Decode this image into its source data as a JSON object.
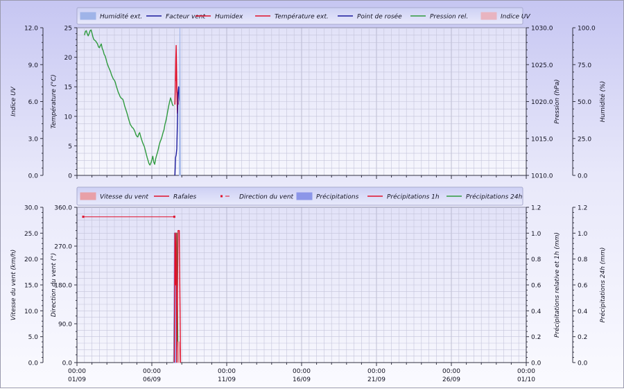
{
  "chart_data": [
    {
      "type": "line",
      "x_axis": {
        "min": "2014-09-01",
        "max": "2014-10-01",
        "tick_step_days": 5
      },
      "legend": [
        {
          "label": "Humidité ext.",
          "kind": "area",
          "color": "#9fb4e8"
        },
        {
          "label": "Facteur vent",
          "kind": "line",
          "color": "#1a1a9c"
        },
        {
          "label": "Humidex",
          "kind": "line",
          "color": "#e0102a"
        },
        {
          "label": "Température ext.",
          "kind": "line",
          "color": "#e0102a"
        },
        {
          "label": "Point de rosée",
          "kind": "line",
          "color": "#1a1a9c"
        },
        {
          "label": "Pression rel.",
          "kind": "line",
          "color": "#2e9a3e"
        },
        {
          "label": "Indice UV",
          "kind": "area",
          "color": "#e8b4c0"
        }
      ],
      "axes": [
        {
          "id": "uv",
          "label": "Indice UV",
          "min": 0,
          "max": 12,
          "ticks": [
            "0.0",
            "3.0",
            "6.0",
            "9.0",
            "12.0"
          ]
        },
        {
          "id": "temp",
          "label": "Température (°C)",
          "min": 0,
          "max": 25,
          "ticks": [
            "0",
            "5",
            "10",
            "15",
            "20",
            "25"
          ]
        },
        {
          "id": "press",
          "label": "Pression (hPa)",
          "min": 1010,
          "max": 1030,
          "ticks": [
            "1010.0",
            "1015.0",
            "1020.0",
            "1025.0",
            "1030.0"
          ]
        },
        {
          "id": "hum",
          "label": "Humidité (%)",
          "min": 0,
          "max": 100,
          "ticks": [
            "0.0",
            "25.0",
            "50.0",
            "75.0",
            "100.0"
          ]
        }
      ],
      "series": [
        {
          "name": "Pression rel.",
          "axis": "press",
          "color": "#2e9a3e",
          "x": [
            "2014-09-01T12:00",
            "2014-09-01T13:30",
            "2014-09-01T15:00",
            "2014-09-01T16:30",
            "2014-09-01T18:00",
            "2014-09-01T19:30",
            "2014-09-01T21:00",
            "2014-09-01T22:30",
            "2014-09-02T00:00",
            "2014-09-02T01:30",
            "2014-09-02T03:00",
            "2014-09-02T04:30",
            "2014-09-02T06:00",
            "2014-09-02T07:30",
            "2014-09-02T09:00",
            "2014-09-02T10:30",
            "2014-09-02T12:00",
            "2014-09-02T13:30",
            "2014-09-02T15:00",
            "2014-09-02T16:30",
            "2014-09-02T18:00",
            "2014-09-02T19:30",
            "2014-09-02T21:00",
            "2014-09-02T22:30",
            "2014-09-03T00:00",
            "2014-09-03T01:30",
            "2014-09-03T03:00",
            "2014-09-03T04:30",
            "2014-09-03T06:00",
            "2014-09-03T07:30",
            "2014-09-03T09:00",
            "2014-09-03T10:30",
            "2014-09-03T12:00",
            "2014-09-03T13:30",
            "2014-09-03T15:00",
            "2014-09-03T16:30",
            "2014-09-03T18:00",
            "2014-09-03T19:30",
            "2014-09-03T21:00",
            "2014-09-03T22:30",
            "2014-09-04T00:00",
            "2014-09-04T01:30",
            "2014-09-04T03:00",
            "2014-09-04T04:30",
            "2014-09-04T06:00",
            "2014-09-04T07:30",
            "2014-09-04T09:00",
            "2014-09-04T10:30",
            "2014-09-04T12:00",
            "2014-09-04T13:30",
            "2014-09-04T15:00",
            "2014-09-04T16:30",
            "2014-09-04T18:00",
            "2014-09-04T19:30",
            "2014-09-04T21:00",
            "2014-09-04T22:30",
            "2014-09-05T00:00",
            "2014-09-05T01:30",
            "2014-09-05T03:00",
            "2014-09-05T04:30",
            "2014-09-05T06:00",
            "2014-09-05T07:30",
            "2014-09-05T09:00",
            "2014-09-05T10:30",
            "2014-09-05T12:00",
            "2014-09-05T13:30",
            "2014-09-05T15:00",
            "2014-09-05T16:30",
            "2014-09-05T18:00",
            "2014-09-05T19:30",
            "2014-09-05T21:00",
            "2014-09-05T22:30",
            "2014-09-06T00:00",
            "2014-09-06T01:30",
            "2014-09-06T03:00",
            "2014-09-06T04:30",
            "2014-09-06T06:00",
            "2014-09-06T07:30",
            "2014-09-06T09:00",
            "2014-09-06T10:30",
            "2014-09-06T12:00",
            "2014-09-06T13:30",
            "2014-09-06T15:00",
            "2014-09-06T16:30",
            "2014-09-06T18:00",
            "2014-09-06T19:30",
            "2014-09-06T21:00",
            "2014-09-06T22:30",
            "2014-09-07T00:00",
            "2014-09-07T01:30",
            "2014-09-07T03:00",
            "2014-09-07T04:30",
            "2014-09-07T06:00",
            "2014-09-07T07:30",
            "2014-09-07T09:00",
            "2014-09-07T10:30"
          ],
          "y": [
            1029.0,
            1029.5,
            1029.6,
            1029.2,
            1028.9,
            1029.2,
            1029.6,
            1029.7,
            1029.3,
            1028.8,
            1028.4,
            1028.3,
            1028.2,
            1028.0,
            1027.8,
            1027.4,
            1027.3,
            1027.6,
            1027.8,
            1027.2,
            1026.9,
            1026.4,
            1026.2,
            1025.8,
            1025.3,
            1024.9,
            1024.6,
            1024.3,
            1024.0,
            1023.6,
            1023.3,
            1023.0,
            1022.9,
            1022.6,
            1022.1,
            1021.7,
            1021.3,
            1021.0,
            1020.7,
            1020.5,
            1020.4,
            1020.3,
            1019.9,
            1019.4,
            1019.0,
            1018.6,
            1018.2,
            1017.7,
            1017.3,
            1016.9,
            1016.7,
            1016.5,
            1016.4,
            1016.2,
            1015.9,
            1015.5,
            1015.3,
            1015.2,
            1015.6,
            1015.8,
            1015.3,
            1014.9,
            1014.5,
            1014.2,
            1013.9,
            1013.4,
            1012.9,
            1012.4,
            1012.0,
            1011.6,
            1011.4,
            1011.7,
            1012.1,
            1012.6,
            1011.8,
            1011.5,
            1012.2,
            1012.7,
            1013.1,
            1013.6,
            1014.2,
            1014.6,
            1014.9,
            1015.3,
            1015.8,
            1016.2,
            1016.9,
            1017.4,
            1018.0,
            1018.7,
            1019.4,
            1020.0,
            1020.5,
            1020.1,
            1019.6,
            1019.4
          ]
        },
        {
          "name": "Température ext.",
          "axis": "temp",
          "color": "#e0102a",
          "x": [
            "2014-09-07T13:00",
            "2014-09-07T13:40",
            "2014-09-07T14:20",
            "2014-09-07T15:00",
            "2014-09-07T15:40",
            "2014-09-07T16:20",
            "2014-09-07T17:00",
            "2014-09-07T17:40",
            "2014-09-07T18:20"
          ],
          "y": [
            12.0,
            15.0,
            19.5,
            22.0,
            18.0,
            13.0,
            10.5,
            14.0,
            12.0
          ]
        },
        {
          "name": "Humidex",
          "axis": "temp",
          "color": "#e0102a",
          "x": [
            "2014-09-07T14:00",
            "2014-09-07T15:00",
            "2014-09-07T16:00"
          ],
          "y": [
            16.0,
            19.0,
            14.0
          ]
        },
        {
          "name": "Point de rosée",
          "axis": "temp",
          "color": "#1a1a9c",
          "x": [
            "2014-09-07T13:00",
            "2014-09-07T14:00",
            "2014-09-07T15:00",
            "2014-09-07T16:00",
            "2014-09-07T17:00",
            "2014-09-07T18:00",
            "2014-09-07T19:00",
            "2014-09-07T20:00",
            "2014-09-07T21:00",
            "2014-09-07T22:00"
          ],
          "y": [
            0.0,
            3.0,
            3.5,
            4.5,
            9.0,
            14.0,
            15.0,
            13.0,
            12.0,
            12.0
          ]
        },
        {
          "name": "Humidité ext.",
          "axis": "hum",
          "color": "#9fb4e8",
          "area": true,
          "x": [
            "2014-09-07T20:00",
            "2014-09-07T20:30",
            "2014-09-07T21:00",
            "2014-09-07T21:30",
            "2014-09-07T22:00"
          ],
          "y": [
            0,
            60,
            100,
            60,
            0
          ]
        }
      ]
    },
    {
      "type": "line",
      "x_axis": {
        "min": "2014-09-01",
        "max": "2014-10-01",
        "tick_step_days": 5
      },
      "x_tick_labels": [
        {
          "time": "00:00",
          "date": "01/09"
        },
        {
          "time": "00:00",
          "date": "06/09"
        },
        {
          "time": "00:00",
          "date": "11/09"
        },
        {
          "time": "00:00",
          "date": "16/09"
        },
        {
          "time": "00:00",
          "date": "21/09"
        },
        {
          "time": "00:00",
          "date": "26/09"
        },
        {
          "time": "00:00",
          "date": "01/10"
        }
      ],
      "legend": [
        {
          "label": "Vitesse du vent",
          "kind": "area",
          "color": "#e8a0a8"
        },
        {
          "label": "Rafales",
          "kind": "line",
          "color": "#e0102a"
        },
        {
          "label": "Direction du vent",
          "kind": "dot",
          "color": "#e0102a"
        },
        {
          "label": "Précipitations",
          "kind": "area",
          "color": "#8c96e8"
        },
        {
          "label": "Précipitations 1h",
          "kind": "line",
          "color": "#e0102a"
        },
        {
          "label": "Précipitations 24h",
          "kind": "line",
          "color": "#2e9a3e"
        }
      ],
      "axes": [
        {
          "id": "speed",
          "label": "Vitesse du vent (km/h)",
          "min": 0,
          "max": 30,
          "ticks": [
            "0.0",
            "5.0",
            "10.0",
            "15.0",
            "20.0",
            "25.0",
            "30.0"
          ]
        },
        {
          "id": "dir",
          "label": "Direction du vent (°)",
          "min": 0,
          "max": 360,
          "ticks": [
            "0.0",
            "90.0",
            "180.0",
            "270.0",
            "360.0"
          ]
        },
        {
          "id": "rain1",
          "label": "Précipitations relative et 1h (mm)",
          "min": 0,
          "max": 1.2,
          "ticks": [
            "0.0",
            "0.2",
            "0.4",
            "0.6",
            "0.8",
            "1.0",
            "1.2"
          ]
        },
        {
          "id": "rain24",
          "label": "Précipitations 24h (mm)",
          "min": 0,
          "max": 1.2,
          "ticks": [
            "0.0",
            "0.2",
            "0.4",
            "0.6",
            "0.8",
            "1.0",
            "1.2"
          ]
        }
      ],
      "series": [
        {
          "name": "Direction du vent",
          "axis": "dir",
          "color": "#e0102a",
          "style": "step-dots",
          "x": [
            "2014-09-01T10:00",
            "2014-09-07T12:00"
          ],
          "y": [
            338,
            338
          ]
        },
        {
          "name": "Précipitations 24h",
          "axis": "rain24",
          "color": "#2e9a3e",
          "x": [
            "2014-09-07T11:00",
            "2014-09-07T13:00",
            "2014-09-07T16:00",
            "2014-09-07T18:00"
          ],
          "y": [
            0.0,
            1.0,
            1.0,
            0.0
          ]
        },
        {
          "name": "Précipitations",
          "axis": "rain1",
          "color": "#8c96e8",
          "area": true,
          "x": [
            "2014-09-07T11:00",
            "2014-09-07T12:00",
            "2014-09-07T14:00",
            "2014-09-07T16:00"
          ],
          "y": [
            0.0,
            1.0,
            1.0,
            0.0
          ]
        },
        {
          "name": "Précipitations 1h",
          "axis": "rain1",
          "color": "#e0102a",
          "x": [
            "2014-09-07T12:00",
            "2014-09-07T13:00",
            "2014-09-07T14:00",
            "2014-09-07T15:00",
            "2014-09-07T16:00"
          ],
          "y": [
            0.0,
            1.0,
            0.6,
            1.0,
            0.0
          ]
        },
        {
          "name": "Rafales",
          "axis": "speed",
          "color": "#e0102a",
          "x": [
            "2014-09-07T16:00",
            "2014-09-07T18:00",
            "2014-09-07T20:00",
            "2014-09-07T22:00"
          ],
          "y": [
            0.0,
            25.5,
            25.5,
            0.0
          ]
        },
        {
          "name": "Vitesse du vent",
          "axis": "speed",
          "color": "#e8a0a8",
          "area": true,
          "x": [
            "2014-09-07T17:00",
            "2014-09-07T18:00",
            "2014-09-07T20:00",
            "2014-09-07T21:00"
          ],
          "y": [
            0.0,
            4.0,
            4.0,
            0.0
          ]
        }
      ]
    }
  ]
}
